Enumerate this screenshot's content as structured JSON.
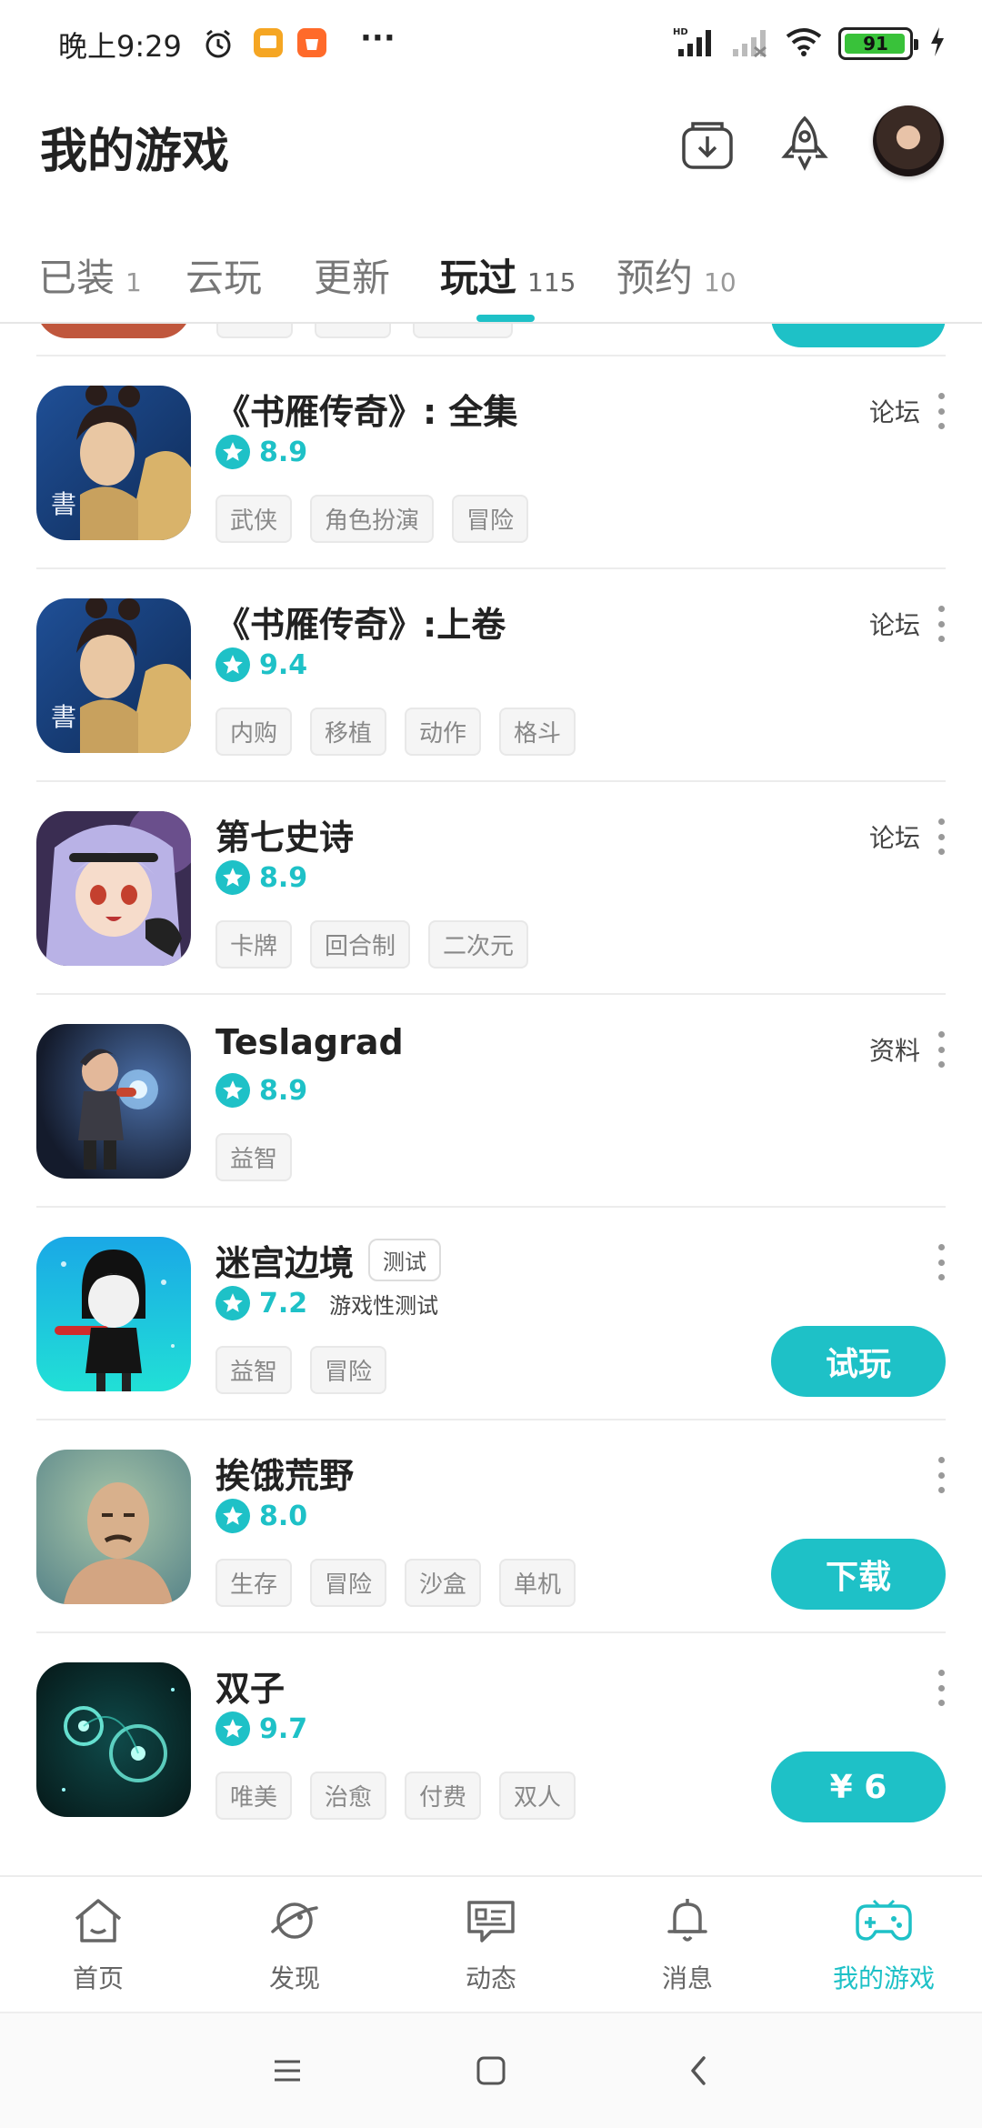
{
  "status_bar": {
    "time": "晚上9:29",
    "more": "···",
    "battery": "91",
    "network": "HD"
  },
  "header": {
    "title": "我的游戏"
  },
  "tabs": [
    {
      "label": "已装",
      "count": "1"
    },
    {
      "label": "云玩",
      "count": ""
    },
    {
      "label": "更新",
      "count": ""
    },
    {
      "label": "玩过",
      "count": "115",
      "active": true
    },
    {
      "label": "预约",
      "count": "10"
    }
  ],
  "games": [
    {
      "name": "《书雁传奇》: 全集",
      "rating": "8.9",
      "tags": [
        "武侠",
        "角色扮演",
        "冒险"
      ],
      "link": "论坛"
    },
    {
      "name": "《书雁传奇》:上卷",
      "rating": "9.4",
      "tags": [
        "内购",
        "移植",
        "动作",
        "格斗"
      ],
      "link": "论坛"
    },
    {
      "name": "第七史诗",
      "rating": "8.9",
      "tags": [
        "卡牌",
        "回合制",
        "二次元"
      ],
      "link": "论坛"
    },
    {
      "name": "Teslagrad",
      "rating": "8.9",
      "tags": [
        "益智"
      ],
      "link": "资料"
    },
    {
      "name": "迷宫边境",
      "badge": "测试",
      "rating": "7.2",
      "note": "游戏性测试",
      "tags": [
        "益智",
        "冒险"
      ],
      "action": "试玩"
    },
    {
      "name": "挨饿荒野",
      "rating": "8.0",
      "tags": [
        "生存",
        "冒险",
        "沙盒",
        "单机"
      ],
      "action": "下载"
    },
    {
      "name": "双子",
      "rating": "9.7",
      "tags": [
        "唯美",
        "治愈",
        "付费",
        "双人"
      ],
      "action": "¥ 6"
    }
  ],
  "bottom_nav": [
    {
      "label": "首页",
      "icon": "home-icon"
    },
    {
      "label": "发现",
      "icon": "planet-icon"
    },
    {
      "label": "动态",
      "icon": "feed-icon"
    },
    {
      "label": "消息",
      "icon": "bell-icon"
    },
    {
      "label": "我的游戏",
      "icon": "gamepad-icon",
      "active": true
    }
  ],
  "colors": {
    "accent": "#1ec1c7",
    "text": "#222222",
    "muted": "#888888"
  }
}
